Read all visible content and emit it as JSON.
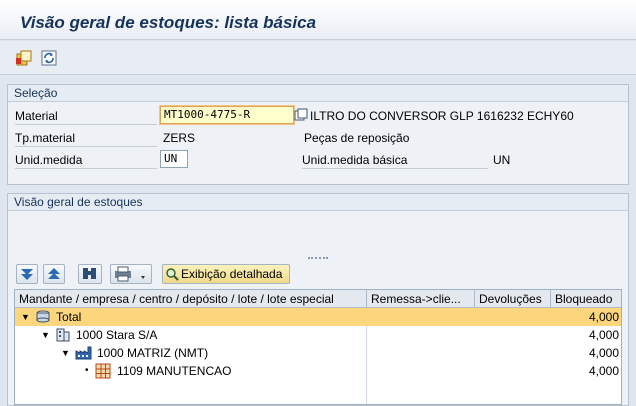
{
  "window": {
    "title": "Visão geral de estoques: lista básica"
  },
  "toolbar": {
    "icons": [
      "select-layout-icon",
      "refresh-icon"
    ]
  },
  "selection": {
    "title": "Seleção",
    "material_label": "Material",
    "material_value": "MT1000-4775-R",
    "material_desc": "ILTRO DO CONVERSOR GLP 1616232 ECHY60",
    "tp_material_label": "Tp.material",
    "tp_material_value": "ZERS",
    "tp_material_desc": "Peças de reposição",
    "unid_label": "Unid.medida",
    "unid_value": "UN",
    "unid_basica_label": "Unid.medida básica",
    "unid_basica_value": "UN"
  },
  "overview": {
    "title": "Visão geral de estoques",
    "detail_button": "Exibição detalhada",
    "columns": [
      "Mandante / empresa / centro / depósito / lote / lote especial",
      "Remessa->clie...",
      "Devoluções",
      "Bloqueado"
    ],
    "rows": [
      {
        "label": "Total",
        "remessa": "",
        "devolucoes": "",
        "bloqueado": "4,000"
      },
      {
        "label": "1000 Stara S/A",
        "remessa": "",
        "devolucoes": "",
        "bloqueado": "4,000"
      },
      {
        "label": "1000 MATRIZ (NMT)",
        "remessa": "",
        "devolucoes": "",
        "bloqueado": "4,000"
      },
      {
        "label": "1109 MANUTENCAO",
        "remessa": "",
        "devolucoes": "",
        "bloqueado": "4,000"
      }
    ]
  },
  "colors": {
    "selected_row": "#fcd57c",
    "title": "#16325c"
  }
}
